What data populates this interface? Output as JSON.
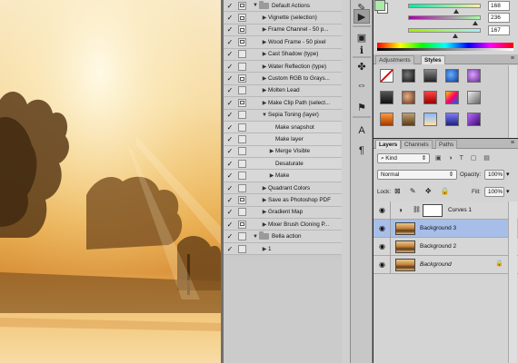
{
  "actions": [
    {
      "label": "Default Actions",
      "level": 0,
      "folder": true,
      "open": true,
      "check": true,
      "box": true
    },
    {
      "label": "Vignette (selection)",
      "level": 1,
      "check": true,
      "box": true
    },
    {
      "label": "Frame Channel - 50 p...",
      "level": 1,
      "check": true,
      "box": true
    },
    {
      "label": "Wood Frame - 50 pixel",
      "level": 1,
      "check": true,
      "box": true
    },
    {
      "label": "Cast Shadow (type)",
      "level": 1,
      "check": true,
      "box": false
    },
    {
      "label": "Water Reflection (type)",
      "level": 1,
      "check": true,
      "box": false
    },
    {
      "label": "Custom RGB to Grays...",
      "level": 1,
      "check": true,
      "box": true
    },
    {
      "label": "Molten Lead",
      "level": 1,
      "check": true,
      "box": false
    },
    {
      "label": "Make Clip Path (select...",
      "level": 1,
      "check": true,
      "box": true
    },
    {
      "label": "Sepia Toning (layer)",
      "level": 1,
      "open": true,
      "check": true,
      "box": false
    },
    {
      "label": "Make snapshot",
      "level": 2,
      "check": true,
      "box": false,
      "sub": true
    },
    {
      "label": "Make layer",
      "level": 2,
      "check": true,
      "box": false,
      "sub": true
    },
    {
      "label": "Merge Visible",
      "level": 2,
      "arrow": true,
      "check": true,
      "box": false,
      "sub": true
    },
    {
      "label": "Desaturate",
      "level": 2,
      "check": true,
      "box": false,
      "sub": true
    },
    {
      "label": "Make",
      "level": 2,
      "arrow": true,
      "check": true,
      "box": false,
      "sub": true
    },
    {
      "label": "Quadrant Colors",
      "level": 1,
      "check": true,
      "box": false
    },
    {
      "label": "Save as Photoshop PDF",
      "level": 1,
      "check": true,
      "box": true
    },
    {
      "label": "Gradient Map",
      "level": 1,
      "check": true,
      "box": false
    },
    {
      "label": "Mixer Brush Cloning P...",
      "level": 1,
      "check": true,
      "box": true
    },
    {
      "label": "Bella action",
      "level": 0,
      "folder": true,
      "open": true,
      "check": true,
      "box": false
    },
    {
      "label": "1",
      "level": 1,
      "check": true,
      "box": false
    }
  ],
  "color": {
    "values": [
      "168",
      "236",
      "167"
    ],
    "fractions": [
      0.66,
      0.92,
      0.65
    ],
    "foreground": "#a8eca7",
    "background": "#ffffff"
  },
  "adjustments": {
    "tabs": [
      "Adjustments",
      "Styles"
    ],
    "active_tab": "Styles"
  },
  "layers": {
    "tabs": [
      "Layers",
      "Channels",
      "Paths"
    ],
    "filter": "Kind",
    "blend_mode": "Normal",
    "opacity_label": "Opacity:",
    "opacity": "100%",
    "lock_label": "Lock:",
    "fill_label": "Fill:",
    "fill": "100%",
    "items": [
      {
        "name": "Curves 1",
        "type": "adjustment",
        "selected": false
      },
      {
        "name": "Background 3",
        "type": "image",
        "selected": true
      },
      {
        "name": "Background 2",
        "type": "image",
        "selected": false
      },
      {
        "name": "Background",
        "type": "image",
        "selected": false,
        "italic": true,
        "locked": true
      }
    ]
  },
  "icons": {
    "visibility": "eye-icon",
    "lock": "lock-icon",
    "play": "play-icon",
    "folder": "folder-icon"
  }
}
